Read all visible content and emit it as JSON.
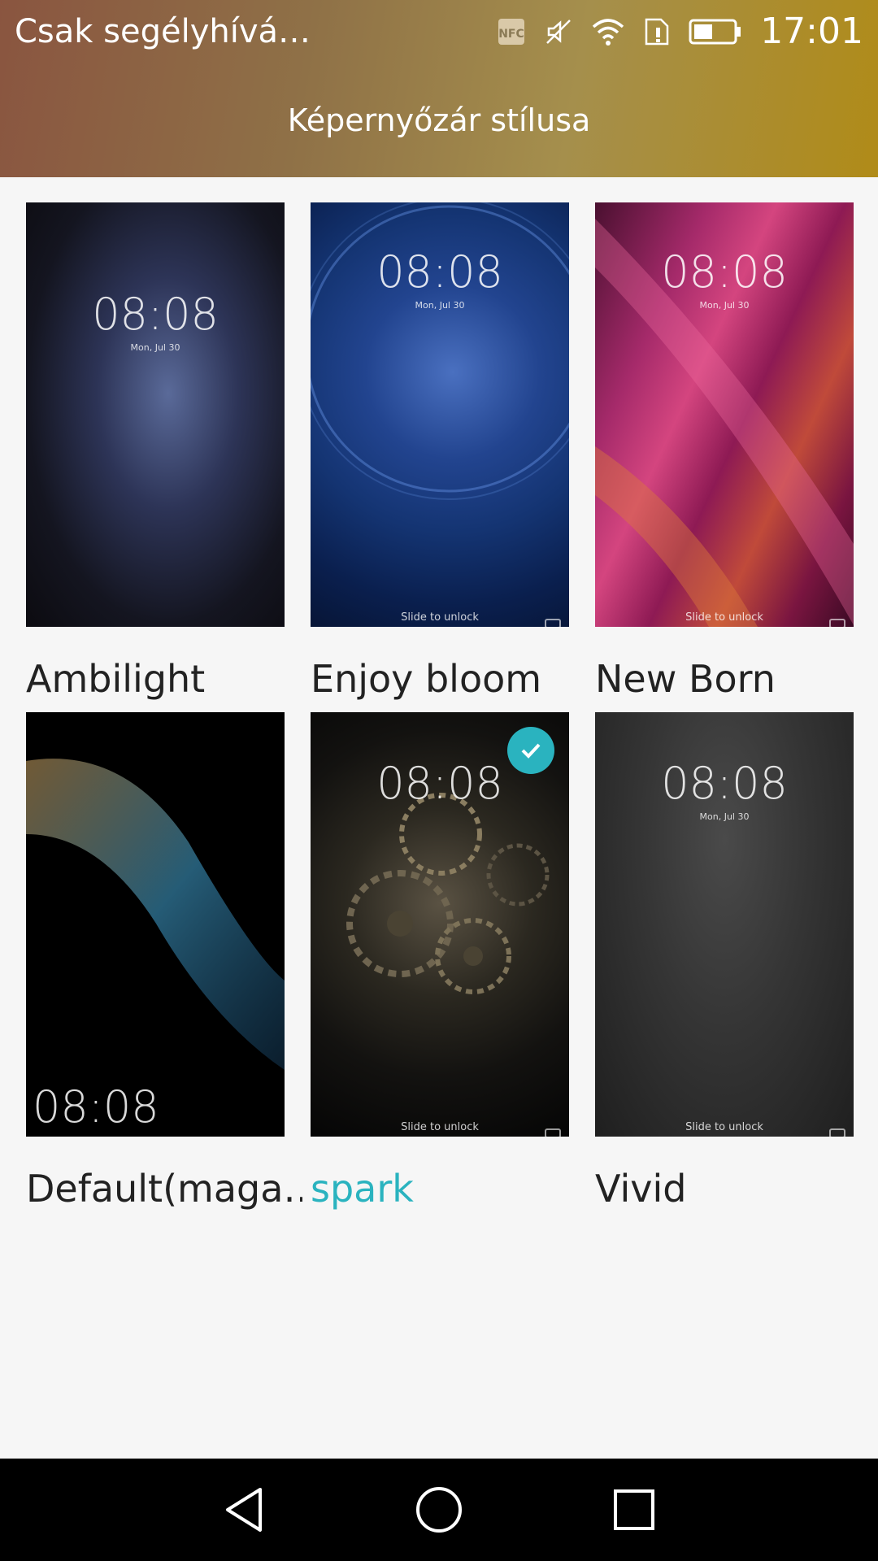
{
  "status_bar": {
    "carrier": "Csak segélyhívá…",
    "time": "17:01",
    "icons": [
      "nfc-icon",
      "silent-icon",
      "wifi-icon",
      "sim-icon",
      "battery-icon"
    ]
  },
  "header": {
    "title": "Képernyőzár stílusa"
  },
  "themes": [
    {
      "name": "Ambilight",
      "time": "08:08",
      "date": "Mon, Jul 30",
      "slide_text": "",
      "selected": false
    },
    {
      "name": "Enjoy bloom",
      "time": "08:08",
      "date": "Mon, Jul 30",
      "slide_text": "Slide to unlock",
      "selected": false
    },
    {
      "name": "New Born",
      "time": "08:08",
      "date": "Mon, Jul 30",
      "slide_text": "Slide to unlock",
      "selected": false
    },
    {
      "name": "Default(maga…",
      "time": "08:08",
      "date": "",
      "slide_text": "",
      "selected": false
    },
    {
      "name": "spark",
      "time": "08:08",
      "date": "",
      "slide_text": "Slide to unlock",
      "selected": true
    },
    {
      "name": "Vivid",
      "time": "08:08",
      "date": "Mon, Jul 30",
      "slide_text": "Slide to unlock",
      "selected": false
    }
  ],
  "colors": {
    "accent": "#2ab3bf",
    "navbar": "#000000",
    "background": "#f6f6f6"
  },
  "navigation": [
    "back-icon",
    "home-icon",
    "recents-icon"
  ]
}
